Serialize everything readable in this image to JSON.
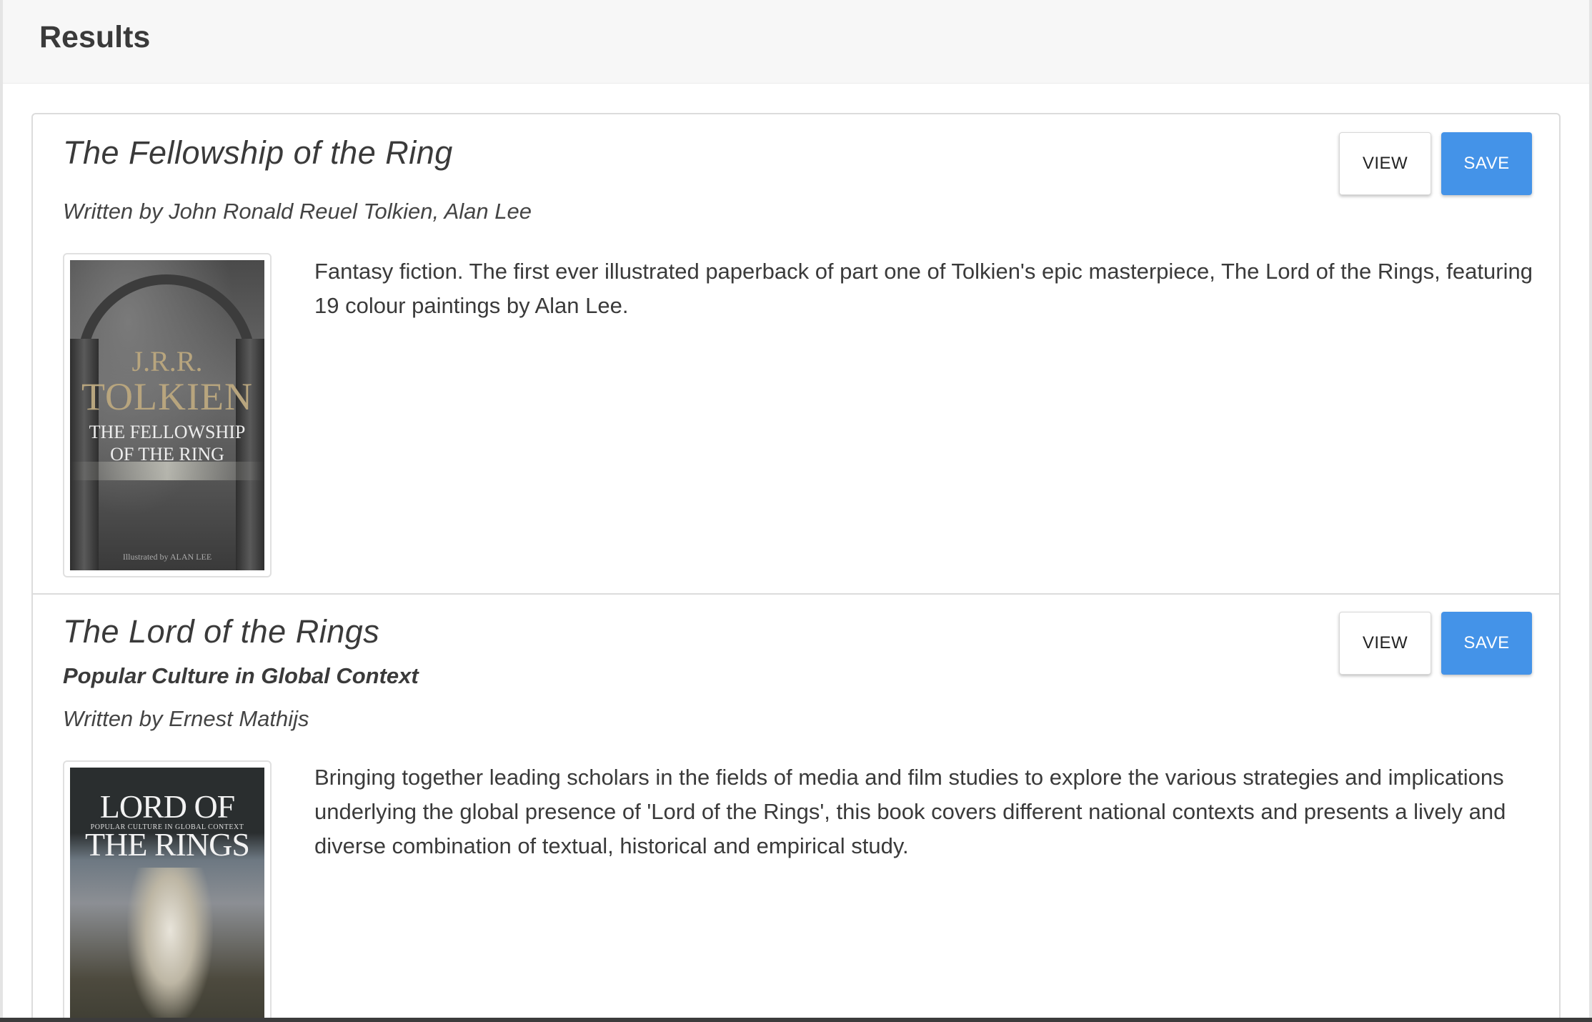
{
  "header": {
    "title": "Results"
  },
  "books": [
    {
      "title": "The Fellowship of the Ring",
      "subtitle": "",
      "author_line": "Written by John Ronald Reuel Tolkien, Alan Lee",
      "description": "Fantasy fiction. The first ever illustrated paperback of part one of Tolkien's epic masterpiece, The Lord of the Rings, featuring 19 colour paintings by Alan Lee.",
      "view_label": "VIEW",
      "save_label": "SAVE",
      "cover": {
        "author_top": "J.R.R.",
        "author_main": "TOLKIEN",
        "title_line1": "THE FELLOWSHIP",
        "title_line2": "OF THE RING",
        "illustrator": "Illustrated by ALAN LEE"
      }
    },
    {
      "title": "The Lord of the Rings",
      "subtitle": "Popular Culture in Global Context",
      "author_line": "Written by Ernest Mathijs",
      "description": "Bringing together leading scholars in the fields of media and film studies to explore the various strategies and implications underlying the global presence of 'Lord of the Rings', this book covers different national contexts and presents a lively and diverse combination of textual, historical and empirical study.",
      "view_label": "VIEW",
      "save_label": "SAVE",
      "cover": {
        "title": "LORD OF THE RINGS",
        "subtitle": "POPULAR CULTURE IN GLOBAL CONTEXT"
      }
    }
  ],
  "colors": {
    "accent": "#4493e8",
    "header_bg": "#f7f7f7",
    "border": "#dcdcdc",
    "text": "#3a3a3a"
  }
}
